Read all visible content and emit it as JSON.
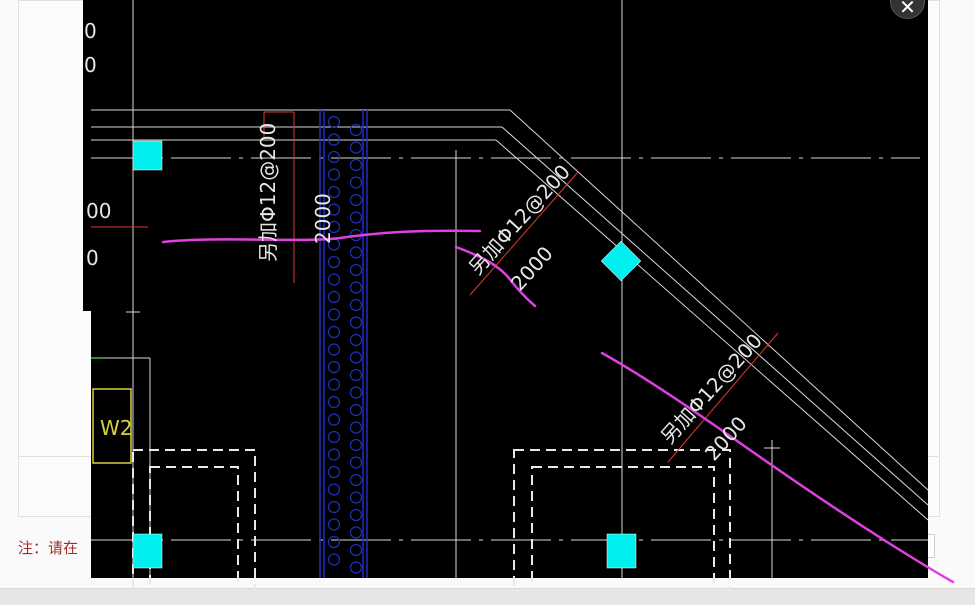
{
  "dialog": {
    "note": "注：请在",
    "close_glyph": "✕"
  },
  "drawing": {
    "dim_label_1": "另加Φ12@200",
    "dim_label_2": "另加Φ12@200",
    "dim_label_3": "另加Φ12@200",
    "length_1": "2000",
    "length_2": "2000",
    "length_3": "2000",
    "wall_tag": "W2",
    "left_num_1": "00",
    "left_num_2": "0",
    "top_num_1": "0",
    "top_num_2": "0"
  },
  "colors": {
    "canvas": "#000000",
    "line": "#d9d9d9",
    "dim": "#e03a2a",
    "cyan": "#00f0f0",
    "magenta": "#e040e0",
    "blue": "#1f2fbf",
    "yellow": "#d7d23a"
  }
}
